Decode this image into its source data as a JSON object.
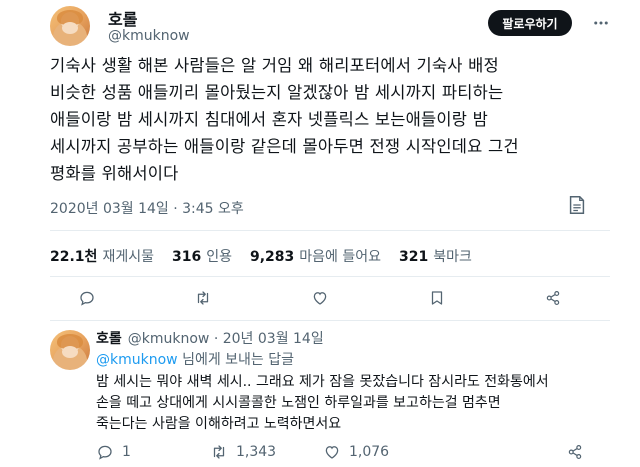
{
  "tweet": {
    "display_name": "호롤",
    "handle": "@kmuknow",
    "follow_label": "팔로우하기",
    "text": "기숙사 생활 해본 사람들은 알 거임 왜 해리포터에서 기숙사 배정\n비슷한 성품 애들끼리 몰아뒀는지 알겠잖아 밤 세시까지 파티하는\n애들이랑 밤 세시까지 침대에서 혼자 넷플릭스 보는애들이랑 밤\n세시까지 공부하는 애들이랑 같은데 몰아두면 전쟁 시작인데요 그건\n평화를 위해서이다",
    "timestamp": "2020년 03월 14일 · 3:45 오후",
    "stats": [
      {
        "value": "22.1천",
        "label": "재게시물"
      },
      {
        "value": "316",
        "label": "인용"
      },
      {
        "value": "9,283",
        "label": "마음에 들어요"
      },
      {
        "value": "321",
        "label": "북마크"
      }
    ]
  },
  "reply": {
    "display_name": "호롤",
    "meta": "@kmuknow · 20년 03월 14일",
    "reply_to_mention": "@kmuknow",
    "reply_to_suffix": " 님에게 보내는 답글",
    "text": "밤 세시는 뭐야 새벽 세시.. 그래요 제가 잠을 못잤습니다 잠시라도 전화통에서\n손을 떼고 상대에게 시시콜콜한 노잼인 하루일과를 보고하는걸 멈추면\n죽는다는 사람을 이해하려고 노력하면서요",
    "counts": {
      "replies": "1",
      "reposts": "1,343",
      "likes": "1,076"
    }
  },
  "colors": {
    "text_primary": "#0f1419",
    "text_secondary": "#536471",
    "mention": "#1d9bf0",
    "divider": "#e6ecf0"
  },
  "icons": [
    "more-icon",
    "bookmark-icon",
    "reply-icon",
    "repost-icon",
    "like-icon",
    "share-icon"
  ]
}
